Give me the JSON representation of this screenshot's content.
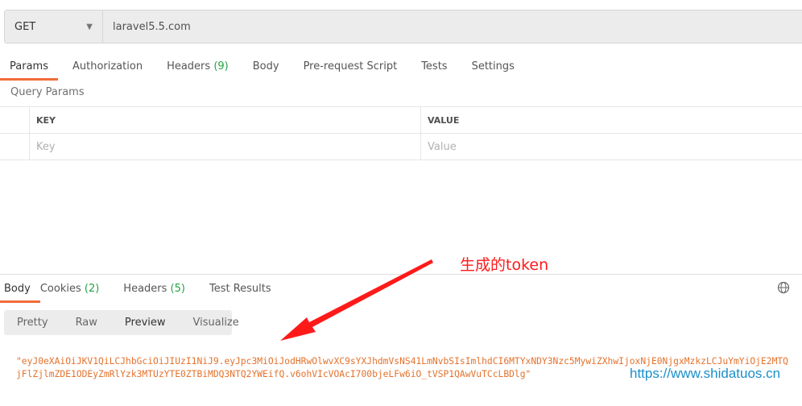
{
  "request": {
    "method": "GET",
    "url": "laravel5.5.com"
  },
  "request_tabs": [
    {
      "label": "Params"
    },
    {
      "label": "Authorization"
    },
    {
      "label": "Headers",
      "count": "(9)"
    },
    {
      "label": "Body"
    },
    {
      "label": "Pre-request Script"
    },
    {
      "label": "Tests"
    },
    {
      "label": "Settings"
    }
  ],
  "query_params": {
    "title": "Query Params",
    "key_header": "KEY",
    "value_header": "VALUE",
    "key_placeholder": "Key",
    "value_placeholder": "Value"
  },
  "response_tabs": [
    {
      "label": "Body"
    },
    {
      "label": "Cookies",
      "count": "(2)"
    },
    {
      "label": "Headers",
      "count": "(5)"
    },
    {
      "label": "Test Results"
    }
  ],
  "view_modes": [
    "Pretty",
    "Raw",
    "Preview",
    "Visualize"
  ],
  "active_view_mode": "Preview",
  "response_body": {
    "line1": "\"eyJ0eXAiOiJKV1QiLCJhbGciOiJIUzI1NiJ9.eyJpc3MiOiJodHRwOlwvXC9sYXJhdmVsNS41LmNvbSIsImlhdCI6MTYxNDY3Nzc5MywiZXhwIjoxNjE0NjgxMzkzLCJuYmYiOjE2MTQ",
    "line2": "jFlZjlmZDE1ODEyZmRlYzk3MTUzYTE0ZTBiMDQ3NTQ2YWEifQ.v6ohVIcVOAcI700bjeLFw6iO_tVSP1QAwVuTCcLBDlg\""
  },
  "annotation": "生成的token",
  "watermark": "https://www.shidatuos.cn",
  "colors": {
    "accent": "#f26b3a",
    "count": "#25a244",
    "token": "#e4722c",
    "annotation": "#ff1a1a",
    "watermark": "#1a8fc9"
  },
  "icons": {
    "method_dropdown": "caret-down-icon",
    "globe": "globe-icon"
  }
}
